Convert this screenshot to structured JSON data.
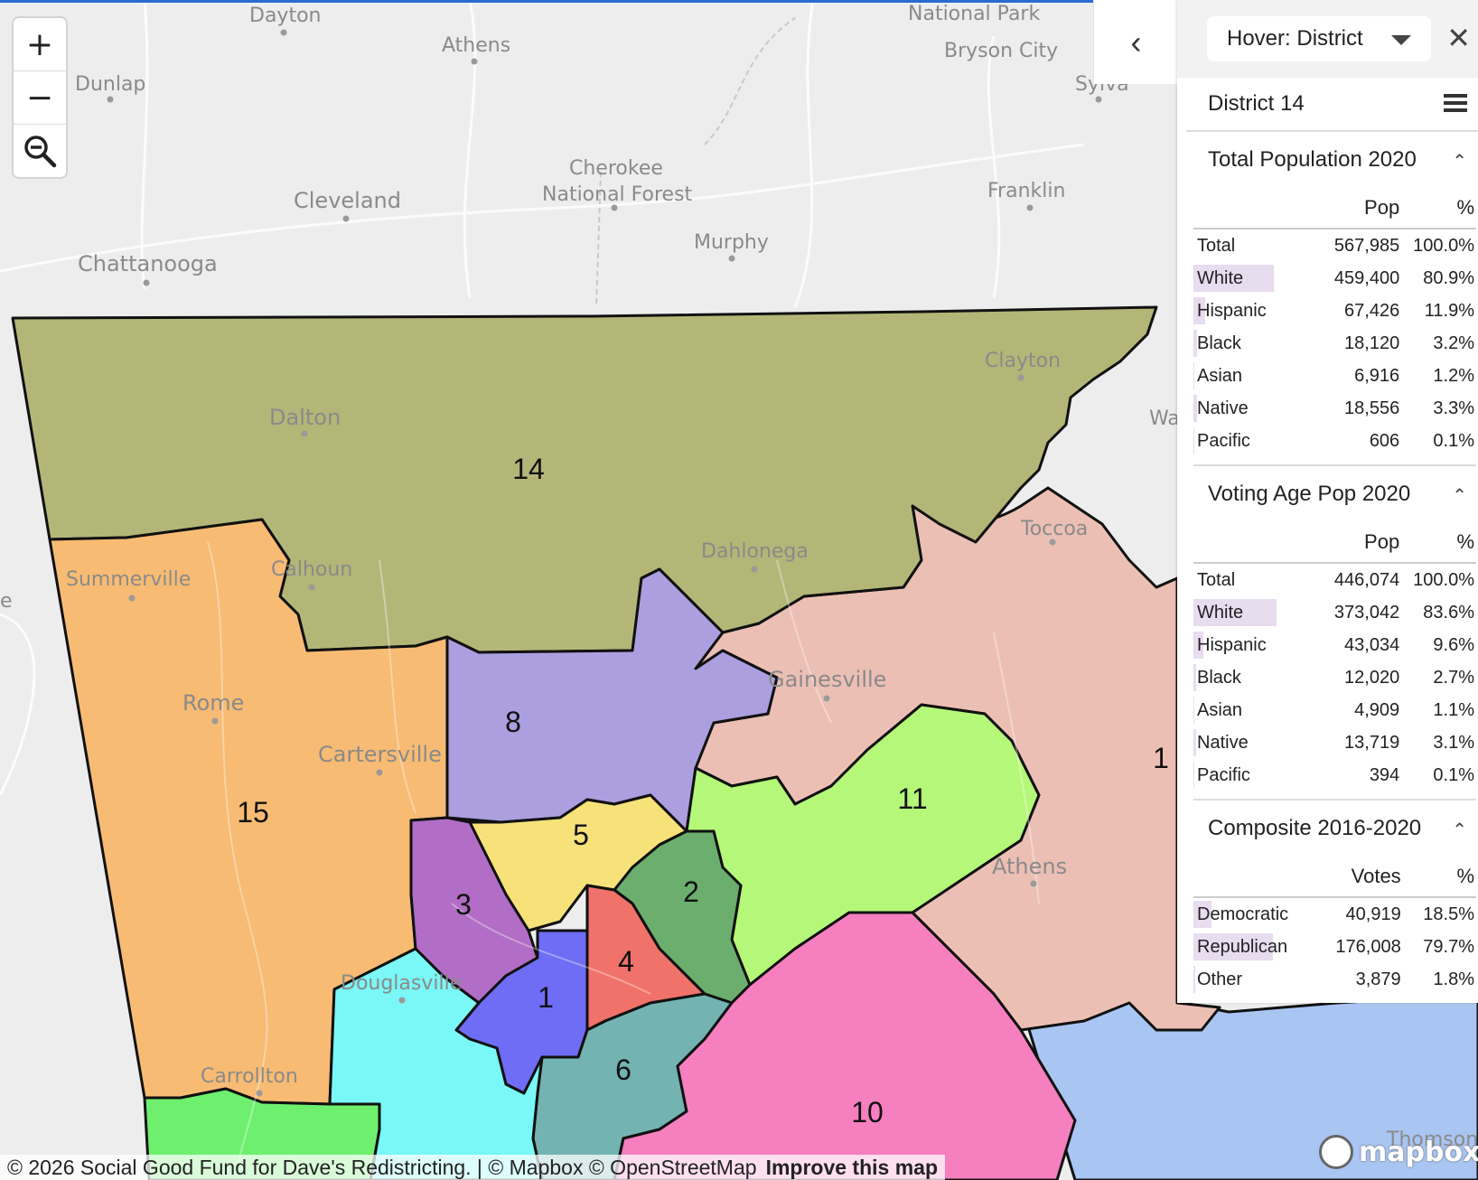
{
  "map": {
    "places": [
      {
        "name": "Dayton",
        "cls": "place small"
      },
      {
        "name": "Athens",
        "cls": "place small"
      },
      {
        "name": "National Park",
        "cls": "place small"
      },
      {
        "name": "Bryson City",
        "cls": "place small"
      },
      {
        "name": "Sylva",
        "cls": "place small"
      },
      {
        "name": "Dunlap",
        "cls": "place small"
      },
      {
        "name": "Cherokee",
        "cls": "place small"
      },
      {
        "name": "National Forest",
        "cls": "place small"
      },
      {
        "name": "Cleveland",
        "cls": "place"
      },
      {
        "name": "Franklin",
        "cls": "place small"
      },
      {
        "name": "Chattanooga",
        "cls": "place"
      },
      {
        "name": "Murphy",
        "cls": "place small"
      },
      {
        "name": "Clayton",
        "cls": "place small"
      },
      {
        "name": "Dalton",
        "cls": "place"
      },
      {
        "name": "Walh",
        "cls": "place small"
      },
      {
        "name": "Toccoa",
        "cls": "place small"
      },
      {
        "name": "Summerville",
        "cls": "place small"
      },
      {
        "name": "Calhoun",
        "cls": "place small"
      },
      {
        "name": "Dahlonega",
        "cls": "place small"
      },
      {
        "name": "e",
        "cls": "place small"
      },
      {
        "name": "Gainesville",
        "cls": "place"
      },
      {
        "name": "Rome",
        "cls": "place"
      },
      {
        "name": "Cartersville",
        "cls": "place"
      },
      {
        "name": "Athens",
        "cls": "place"
      },
      {
        "name": "Douglasville",
        "cls": "place small"
      },
      {
        "name": "Carrollton",
        "cls": "place small"
      },
      {
        "name": "Thomson",
        "cls": "place small"
      }
    ],
    "districts": [
      {
        "id": "14",
        "label": "14",
        "color": "#b3b677"
      },
      {
        "id": "15",
        "label": "15",
        "color": "#f7bb74"
      },
      {
        "id": "8",
        "label": "8",
        "color": "#ab9fe0"
      },
      {
        "id": "9",
        "label": "1",
        "color": "#ecbfb5"
      },
      {
        "id": "11",
        "label": "11",
        "color": "#b5f779"
      },
      {
        "id": "5",
        "label": "5",
        "color": "#f7e27a"
      },
      {
        "id": "3",
        "label": "3",
        "color": "#b26dc7"
      },
      {
        "id": "2",
        "label": "2",
        "color": "#6cae6e"
      },
      {
        "id": "4",
        "label": "4",
        "color": "#f0726a"
      },
      {
        "id": "1",
        "label": "1",
        "color": "#6f6cf5"
      },
      {
        "id": "6",
        "label": "6",
        "color": "#73b3b2"
      },
      {
        "id": "10",
        "label": "10",
        "color": "#f67fbf"
      },
      {
        "id": "13",
        "label": "",
        "color": "#7af7f7"
      },
      {
        "id": "12",
        "label": "",
        "color": "#a9c5f2"
      },
      {
        "id": "7",
        "label": "",
        "color": "#6ef06e"
      }
    ]
  },
  "zoom": {
    "in": "+",
    "out": "−"
  },
  "panel": {
    "hover_select": "Hover: District",
    "close": "✕",
    "collapse": "‹",
    "district_title": "District 14",
    "sections": [
      {
        "title": "Total Population 2020",
        "col1": "Pop",
        "col2": "%",
        "rows": [
          {
            "label": "Total",
            "v": "567,985",
            "p": "100.0%",
            "bar": 0
          },
          {
            "label": "White",
            "v": "459,400",
            "p": "80.9%",
            "bar": 0.809
          },
          {
            "label": "Hispanic",
            "v": "67,426",
            "p": "11.9%",
            "bar": 0.119
          },
          {
            "label": "Black",
            "v": "18,120",
            "p": "3.2%",
            "bar": 0.032
          },
          {
            "label": "Asian",
            "v": "6,916",
            "p": "1.2%",
            "bar": 0.012
          },
          {
            "label": "Native",
            "v": "18,556",
            "p": "3.3%",
            "bar": 0.033
          },
          {
            "label": "Pacific",
            "v": "606",
            "p": "0.1%",
            "bar": 0.001
          }
        ]
      },
      {
        "title": "Voting Age Pop 2020",
        "col1": "Pop",
        "col2": "%",
        "rows": [
          {
            "label": "Total",
            "v": "446,074",
            "p": "100.0%",
            "bar": 0
          },
          {
            "label": "White",
            "v": "373,042",
            "p": "83.6%",
            "bar": 0.836
          },
          {
            "label": "Hispanic",
            "v": "43,034",
            "p": "9.6%",
            "bar": 0.096
          },
          {
            "label": "Black",
            "v": "12,020",
            "p": "2.7%",
            "bar": 0.027
          },
          {
            "label": "Asian",
            "v": "4,909",
            "p": "1.1%",
            "bar": 0.011
          },
          {
            "label": "Native",
            "v": "13,719",
            "p": "3.1%",
            "bar": 0.031
          },
          {
            "label": "Pacific",
            "v": "394",
            "p": "0.1%",
            "bar": 0.001
          }
        ]
      },
      {
        "title": "Composite 2016-2020",
        "col1": "Votes",
        "col2": "%",
        "rows": [
          {
            "label": "Democratic",
            "v": "40,919",
            "p": "18.5%",
            "bar": 0.185
          },
          {
            "label": "Republican",
            "v": "176,008",
            "p": "79.7%",
            "bar": 0.797
          },
          {
            "label": "Other",
            "v": "3,879",
            "p": "1.8%",
            "bar": 0.018
          }
        ]
      }
    ]
  },
  "attribution": {
    "text": "© 2026 Social Good Fund for Dave's Redistricting. | © Mapbox © OpenStreetMap",
    "improve": "Improve this map"
  },
  "logo": "mapbox"
}
